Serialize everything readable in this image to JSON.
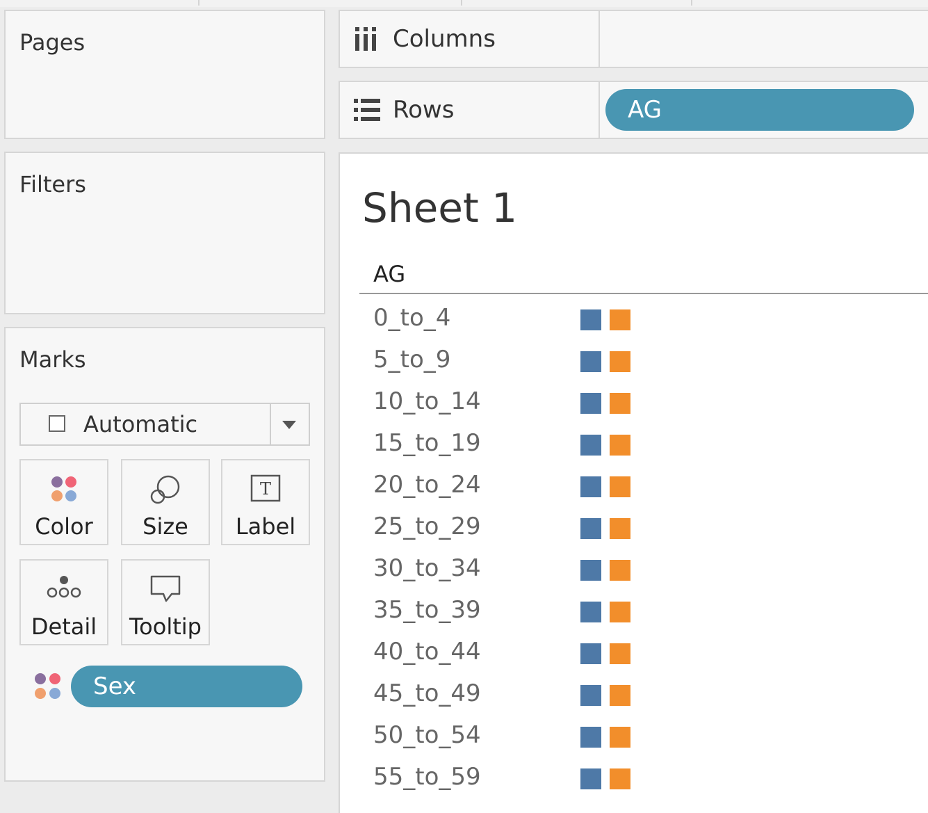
{
  "left_panel": {
    "pages_title": "Pages",
    "filters_title": "Filters",
    "marks_title": "Marks",
    "mark_type": "Automatic",
    "buttons": [
      "Color",
      "Size",
      "Label",
      "Detail",
      "Tooltip"
    ],
    "color_pill": "Sex"
  },
  "shelves": {
    "columns_label": "Columns",
    "rows_label": "Rows",
    "rows_pill": "AG"
  },
  "sheet": {
    "title": "Sheet 1",
    "row_header": "AG",
    "rows": [
      "0_to_4",
      "5_to_9",
      "10_to_14",
      "15_to_19",
      "20_to_24",
      "25_to_29",
      "30_to_34",
      "35_to_39",
      "40_to_44",
      "45_to_49",
      "50_to_54",
      "55_to_59"
    ],
    "series_colors": [
      "#4e79a7",
      "#f28e2b"
    ]
  },
  "colors": {
    "pill": "#4996b2",
    "palette_icon": [
      "#8a6f9e",
      "#f06476",
      "#f0a06e",
      "#89a9d6"
    ]
  }
}
